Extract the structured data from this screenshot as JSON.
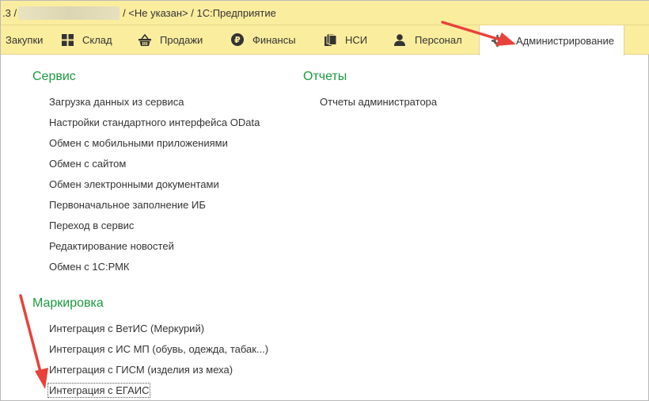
{
  "titlebar": {
    "prefix": ".3 /",
    "rest": "/ <Не указан> / 1С:Предприятие"
  },
  "tabs": [
    {
      "label": "Закупки",
      "icon": "cart-icon",
      "active": false
    },
    {
      "label": "Склад",
      "icon": "grid-icon",
      "active": false
    },
    {
      "label": "Продажи",
      "icon": "basket-icon",
      "active": false
    },
    {
      "label": "Финансы",
      "icon": "ruble-icon",
      "active": false
    },
    {
      "label": "НСИ",
      "icon": "documents-icon",
      "active": false
    },
    {
      "label": "Персонал",
      "icon": "person-icon",
      "active": false
    },
    {
      "label": "Администрирование",
      "icon": "gear-icon",
      "active": true
    }
  ],
  "sections": {
    "service": {
      "title": "Сервис",
      "items": [
        "Загрузка данных из сервиса",
        "Настройки стандартного интерфейса OData",
        "Обмен с мобильными приложениями",
        "Обмен с сайтом",
        "Обмен электронными документами",
        "Первоначальное заполнение ИБ",
        "Переход в сервис",
        "Редактирование новостей",
        "Обмен с 1С:РМК"
      ]
    },
    "reports": {
      "title": "Отчеты",
      "items": [
        "Отчеты администратора"
      ]
    },
    "marking": {
      "title": "Маркировка",
      "items": [
        "Интеграция с ВетИС (Меркурий)",
        "Интеграция с ИС МП (обувь, одежда, табак...)",
        "Интеграция с ГИСМ (изделия из меха)",
        "Интеграция с ЕГАИС"
      ]
    }
  },
  "colors": {
    "accent": "#fbed9e",
    "section_title": "#1a9a3e",
    "annotation_arrow": "#e8423b"
  }
}
